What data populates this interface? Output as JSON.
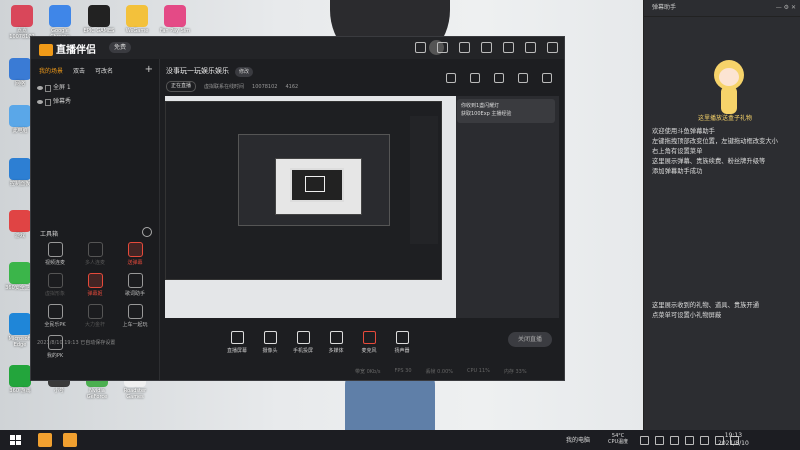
{
  "desktop": {
    "icons": [
      {
        "label": "嘉嘉 10078102",
        "color": "#d9475a"
      },
      {
        "label": "Google Chrome",
        "color": "#3f86e8"
      },
      {
        "label": "EPIC GAMES",
        "color": "#222222"
      },
      {
        "label": "WeGame",
        "color": "#f3c13b"
      },
      {
        "label": "Fan Pay Sim",
        "color": "#e44a86"
      },
      {
        "label": "网络",
        "color": "#3a7bd5"
      },
      {
        "label": "此电脑",
        "color": "#5aa7e8"
      },
      {
        "label": "控制面板",
        "color": "#2d7fd3"
      },
      {
        "label": "游戏",
        "color": "#e04444"
      },
      {
        "label": "360安全卫士",
        "color": "#3bb54a"
      },
      {
        "label": "Microsoft Edge",
        "color": "#1f86d8"
      },
      {
        "label": "360 游戏",
        "color": "#23a53c"
      },
      {
        "label": "小号",
        "color": "#3a3a3a"
      },
      {
        "label": "Nvidia GeForce",
        "color": "#4caf50"
      },
      {
        "label": "Roadster Games",
        "color": "#f0f0f0"
      }
    ]
  },
  "app": {
    "name": "直播伴侣",
    "version_label": "免费",
    "sidebar": {
      "tabs": [
        "我的场景",
        "双击",
        "可改名"
      ],
      "active_tab": 0,
      "scenes": [
        "全屏 1",
        "弹幕秀"
      ],
      "toolbox_label": "工具箱",
      "tools": [
        {
          "label": "视频连麦",
          "style": "normal"
        },
        {
          "label": "多人连麦",
          "style": "dim"
        },
        {
          "label": "送弹幕",
          "style": "red"
        },
        {
          "label": "虚拟形象",
          "style": "dim"
        },
        {
          "label": "弹幕姬",
          "style": "red"
        },
        {
          "label": "歌词助手",
          "style": "normal"
        },
        {
          "label": "全民乐PK",
          "style": "normal"
        },
        {
          "label": "大力金杆",
          "style": "dim"
        },
        {
          "label": "上车一起玩",
          "style": "normal"
        },
        {
          "label": "我的PK",
          "style": "normal"
        }
      ],
      "bottom_text": "2021/8/10 19:13 已自动保存设置"
    },
    "main": {
      "room_title": "没事玩一玩娱乐娱乐",
      "edit_label": "修改",
      "status_tag": "正在直播",
      "room_text": "虚拟联系在线时间",
      "room_id": "10078102",
      "fans": "4162",
      "gift_toast_line1": "你收到1盏闪耀灯",
      "gift_toast_line2": "获取100Exp 主播经验",
      "bottom_buttons": [
        {
          "label": "直播屏幕",
          "style": "normal"
        },
        {
          "label": "摄像头",
          "style": "normal"
        },
        {
          "label": "手机投屏",
          "style": "normal"
        },
        {
          "label": "多媒体",
          "style": "normal"
        },
        {
          "label": "麦克风",
          "style": "red"
        },
        {
          "label": "扬声器",
          "style": "normal"
        }
      ],
      "live_button": "关闭直播",
      "status_items": [
        "带宽 0Kb/s",
        "FPS 30",
        "丢帧 0.00%",
        "CPU 11%",
        "内存 33%"
      ]
    }
  },
  "chat_panel": {
    "title": "弹幕助手",
    "mascot_caption": "这里播放送盒子礼物",
    "lines_top": [
      "欢迎使用斗鱼弹幕助手",
      "左键拖拽顶部改变位置，左键拖动框改变大小",
      "右上角有设置菜单",
      "这里展示弹幕、贵族续费、粉丝牌升级等",
      "添加弹幕助手成功"
    ],
    "lines_bottom": [
      "这里展示收到的礼物、道具、贵族开通",
      "点菜单可设置小礼物屏蔽"
    ]
  },
  "taskbar": {
    "tray_label": "我的电脑",
    "temperature": "54°C",
    "cpu_temp_label": "CPU温度",
    "time": "19:13",
    "date": "2021/8/10"
  }
}
